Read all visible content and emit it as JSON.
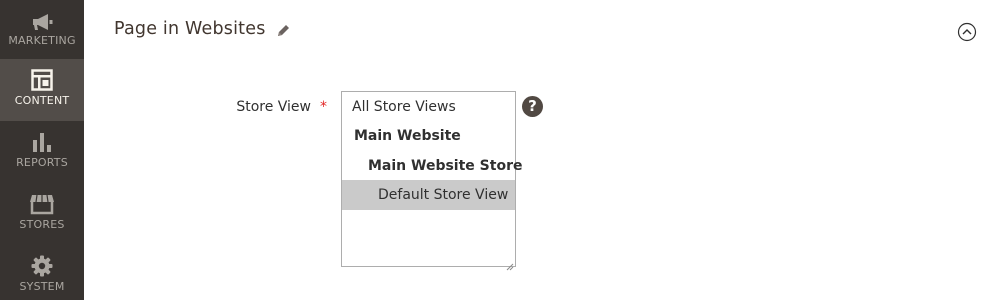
{
  "sidebar": {
    "items": [
      {
        "label": "MARKETING",
        "icon": "megaphone-icon",
        "active": false
      },
      {
        "label": "CONTENT",
        "icon": "layout-icon",
        "active": true
      },
      {
        "label": "REPORTS",
        "icon": "bar-chart-icon",
        "active": false
      },
      {
        "label": "STORES",
        "icon": "storefront-icon",
        "active": false
      },
      {
        "label": "SYSTEM",
        "icon": "gear-icon",
        "active": false
      }
    ]
  },
  "section": {
    "title": "Page in Websites",
    "edit_icon": "pencil-icon",
    "collapse_icon": "chevron-up-circle-icon"
  },
  "store_view": {
    "label": "Store View",
    "required_marker": "*",
    "help": "?",
    "options": [
      {
        "label": "All Store Views",
        "bold": false,
        "selected": false
      },
      {
        "label": "Main Website",
        "bold": true,
        "selected": false
      },
      {
        "label": "Main Website Store",
        "bold": true,
        "selected": false
      },
      {
        "label": "Default Store View",
        "bold": false,
        "selected": true
      }
    ]
  },
  "colors": {
    "sidebar_bg": "#373330",
    "sidebar_active_bg": "#524d49",
    "required": "#e22626",
    "selected_option_bg": "#cacaca"
  }
}
